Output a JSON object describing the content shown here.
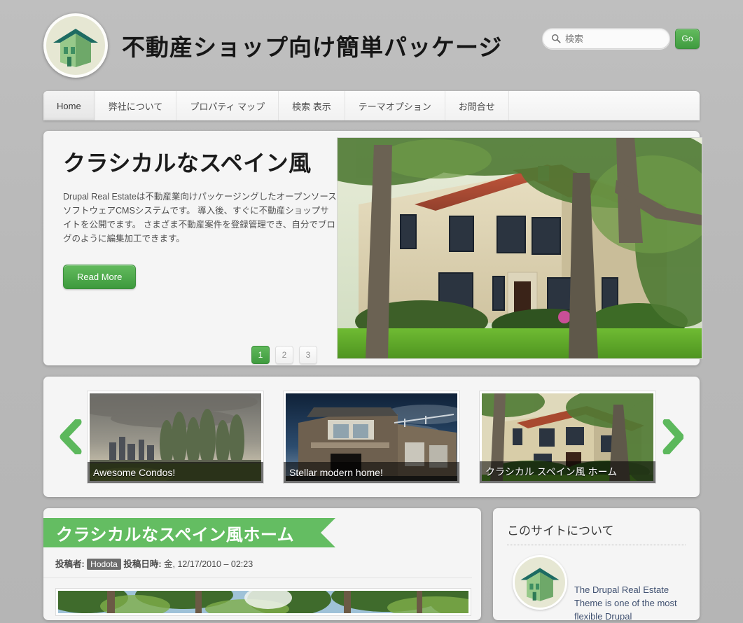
{
  "header": {
    "site_title": "不動産ショップ向け簡単パッケージ",
    "logo_icon": "house-logo-icon"
  },
  "search": {
    "placeholder": "検索",
    "value": "",
    "icon": "search-icon",
    "go_label": "Go"
  },
  "nav": {
    "items": [
      {
        "label": "Home",
        "active": true
      },
      {
        "label": "弊社について",
        "active": false
      },
      {
        "label": "プロパティ マップ",
        "active": false
      },
      {
        "label": "検索 表示",
        "active": false
      },
      {
        "label": "テーマオプション",
        "active": false
      },
      {
        "label": "お問合せ",
        "active": false
      }
    ]
  },
  "hero": {
    "title": "クラシカルなスペイン風",
    "body": "Drupal Real Estateは不動産業向けパッケージングしたオープンソースソフトウェアCMSシステムです。 導入後、すぐに不動産ショップサイトを公開でます。 さまざま不動産案件を登録管理でき、自分でブログのように編集加工できます。",
    "read_more_label": "Read More",
    "pager": [
      "1",
      "2",
      "3"
    ],
    "active_page": "1",
    "image_alt": "classical-spanish-villa-photo"
  },
  "carousel": {
    "prev_icon": "chevron-left-icon",
    "next_icon": "chevron-right-icon",
    "slides": [
      {
        "caption": "Awesome Condos!",
        "image_alt": "city-skyline-with-trees-photo"
      },
      {
        "caption": "Stellar modern home!",
        "image_alt": "modern-stone-house-photo"
      },
      {
        "caption": "クラシカル スペイン風 ホーム",
        "image_alt": "spanish-style-home-photo"
      }
    ]
  },
  "article": {
    "title": "クラシカルなスペイン風ホーム",
    "author_label": "投稿者:",
    "author": "Hodota",
    "date_label": "投稿日時:",
    "date": "金, 12/17/2010 – 02:23",
    "image_alt": "forest-canopy-photo"
  },
  "sidebar": {
    "title": "このサイトについて",
    "logo_icon": "house-logo-icon",
    "text": "The Drupal Real Estate Theme is one of the most flexible Drupal"
  },
  "colors": {
    "accent_green": "#5cb85c",
    "ribbon_green": "#64bd62",
    "page_background": "#b9b9b9",
    "panel_background": "#f5f5f5",
    "logo_roof": "#1d6b62",
    "logo_wall": "#85bd7a",
    "logo_circle": "#e6e7d3"
  }
}
